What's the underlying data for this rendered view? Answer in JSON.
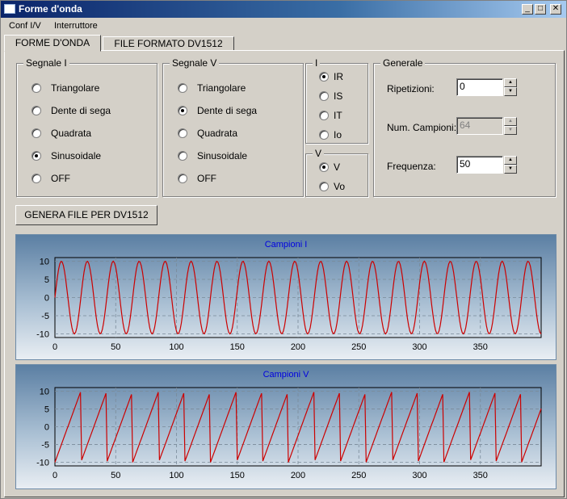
{
  "window": {
    "title": "Forme d'onda",
    "min_label": "_",
    "max_label": "□",
    "close_label": "✕"
  },
  "menu": [
    "Conf I/V",
    "Interruttore"
  ],
  "tabs": [
    "FORME D'ONDA",
    "FILE FORMATO DV1512"
  ],
  "segnale_i": {
    "title": "Segnale I",
    "options": [
      "Triangolare",
      "Dente di sega",
      "Quadrata",
      "Sinusoidale",
      "OFF"
    ],
    "selected": 3
  },
  "segnale_v": {
    "title": "Segnale V",
    "options": [
      "Triangolare",
      "Dente di sega",
      "Quadrata",
      "Sinusoidale",
      "OFF"
    ],
    "selected": 1
  },
  "group_i": {
    "title": "I",
    "options": [
      "IR",
      "IS",
      "IT",
      "Io"
    ],
    "selected": 0
  },
  "group_v": {
    "title": "V",
    "options": [
      "V",
      "Vo"
    ],
    "selected": 0
  },
  "generale": {
    "title": "Generale",
    "ripetizioni": {
      "label": "Ripetizioni:",
      "value": "0"
    },
    "num_campioni": {
      "label": "Num. Campioni:",
      "value": "64",
      "disabled": true
    },
    "frequenza": {
      "label": "Frequenza:",
      "value": "50"
    }
  },
  "generate_button": "GENERA FILE PER DV1512",
  "chart_data": [
    {
      "type": "line",
      "title": "Campioni I",
      "waveform": "sine",
      "series": [
        {
          "values_generated": "sine wave, amplitude 10, period ~21.33 samples, 400 samples",
          "color": "#cc0000"
        }
      ],
      "x_range": [
        0,
        400
      ],
      "y_range": [
        -11,
        11
      ],
      "x_ticks": [
        0,
        50,
        100,
        150,
        200,
        250,
        300,
        350
      ],
      "y_ticks": [
        10,
        5,
        0,
        -5,
        -10
      ],
      "amplitude": 10,
      "period": 21.33,
      "samples": 400,
      "grid": true
    },
    {
      "type": "line",
      "title": "Campioni V",
      "waveform": "sawtooth",
      "series": [
        {
          "values_generated": "sawtooth wave, amplitude 10, period ~21.33 samples, 400 samples",
          "color": "#cc0000"
        }
      ],
      "x_range": [
        0,
        400
      ],
      "y_range": [
        -11,
        11
      ],
      "x_ticks": [
        0,
        50,
        100,
        150,
        200,
        250,
        300,
        350
      ],
      "y_ticks": [
        10,
        5,
        0,
        -5,
        -10
      ],
      "amplitude": 10,
      "period": 21.33,
      "samples": 400,
      "grid": true
    }
  ],
  "colors": {
    "line": "#cc0000",
    "chart_title": "#0000e0",
    "titlebar": "#0a246a"
  }
}
